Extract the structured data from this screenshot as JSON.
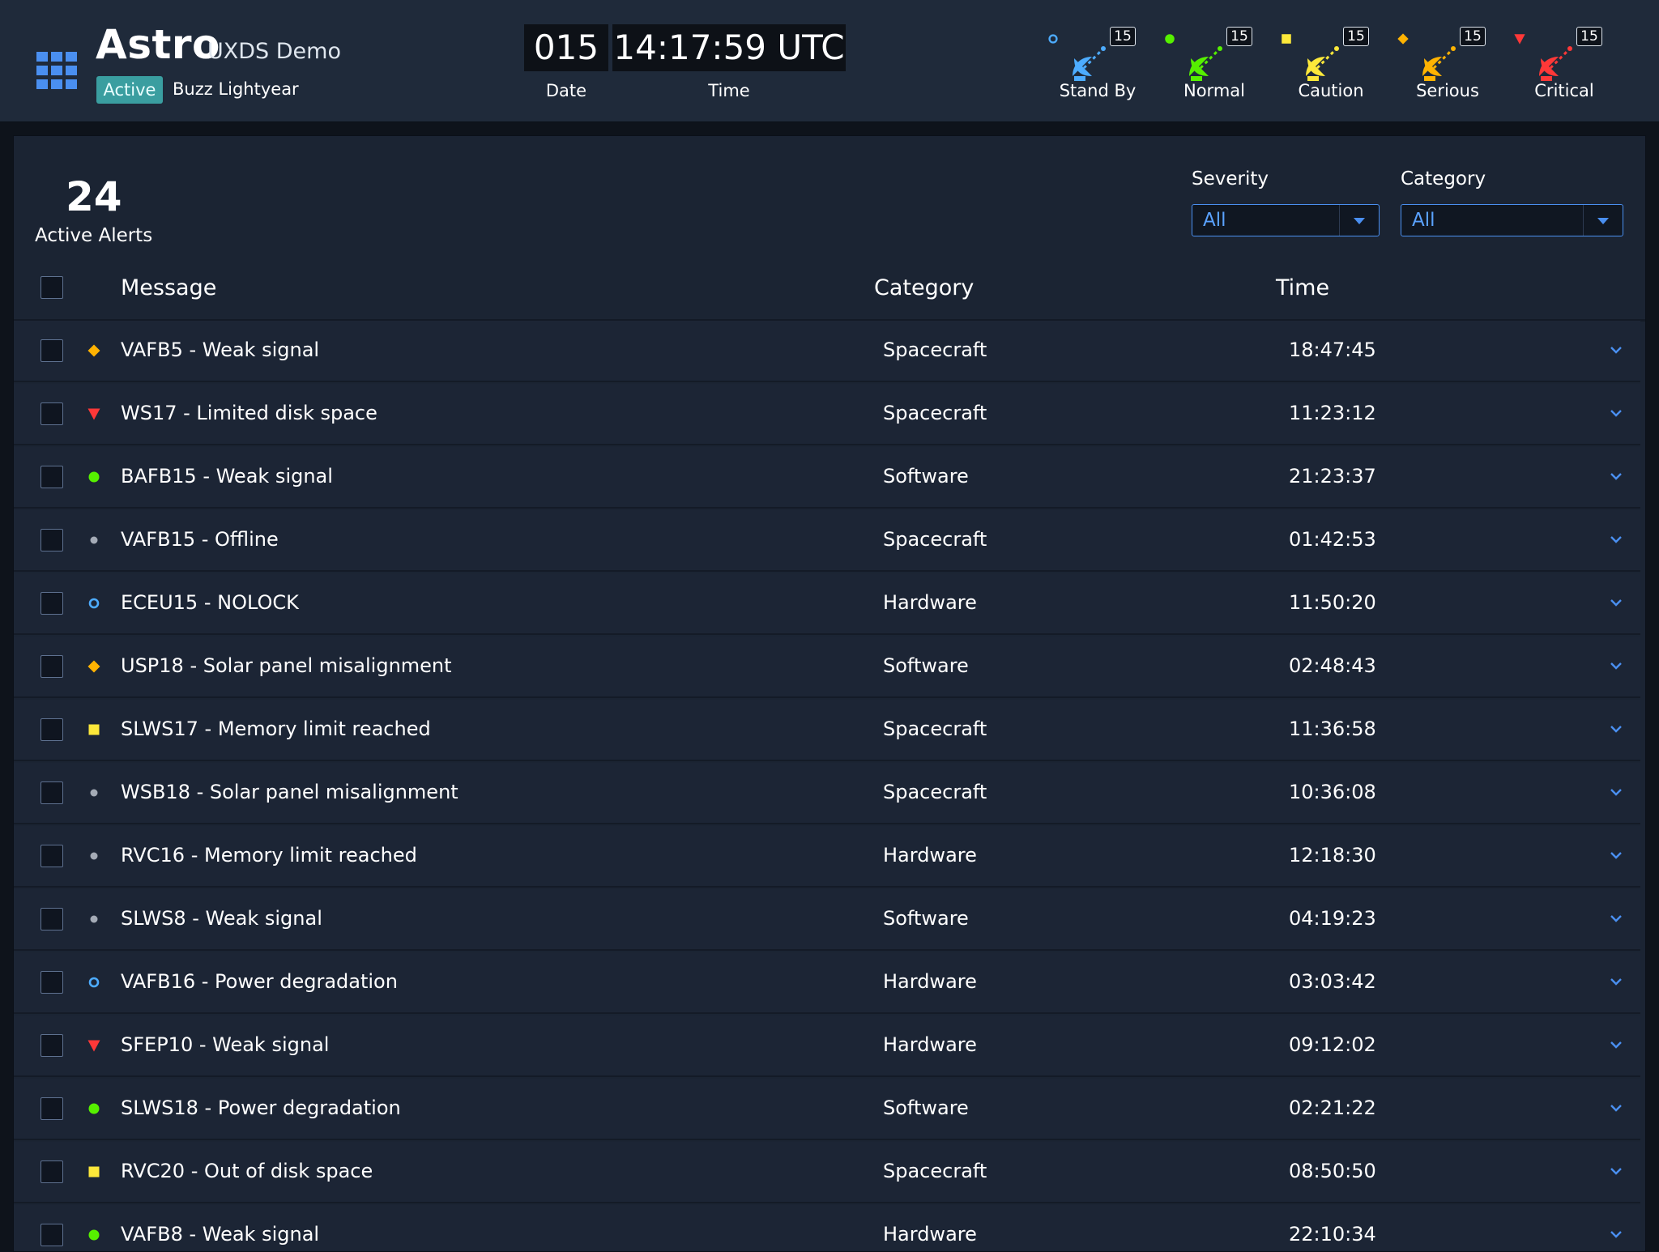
{
  "header": {
    "app_name": "Astro",
    "app_subtitle": "UXDS Demo",
    "state": "Active",
    "user": "Buzz Lightyear",
    "date_value": "015",
    "date_label": "Date",
    "time_value": "14:17:59 UTC",
    "time_label": "Time"
  },
  "monitoring": [
    {
      "label": "Stand By",
      "count": "15",
      "color": "#4dacff",
      "icon": "standby-icon"
    },
    {
      "label": "Normal",
      "count": "15",
      "color": "#56f000",
      "icon": "normal-icon"
    },
    {
      "label": "Caution",
      "count": "15",
      "color": "#fce83a",
      "icon": "caution-icon"
    },
    {
      "label": "Serious",
      "count": "15",
      "color": "#ffb302",
      "icon": "serious-icon"
    },
    {
      "label": "Critical",
      "count": "15",
      "color": "#ff3838",
      "icon": "critical-icon"
    }
  ],
  "alerts": {
    "count": "24",
    "count_label": "Active Alerts",
    "severity_label": "Severity",
    "severity_value": "All",
    "category_label": "Category",
    "category_value": "All",
    "columns": {
      "message": "Message",
      "category": "Category",
      "time": "Time"
    },
    "rows": [
      {
        "severity": "serious",
        "message": "VAFB5 - Weak signal",
        "category": "Spacecraft",
        "time": "18:47:45"
      },
      {
        "severity": "critical",
        "message": "WS17 - Limited disk space",
        "category": "Spacecraft",
        "time": "11:23:12"
      },
      {
        "severity": "normal",
        "message": "BAFB15 - Weak signal",
        "category": "Software",
        "time": "21:23:37"
      },
      {
        "severity": "off",
        "message": "VAFB15 - Offline",
        "category": "Spacecraft",
        "time": "01:42:53"
      },
      {
        "severity": "standby",
        "message": "ECEU15 - NOLOCK",
        "category": "Hardware",
        "time": "11:50:20"
      },
      {
        "severity": "serious",
        "message": "USP18 - Solar panel misalignment",
        "category": "Software",
        "time": "02:48:43"
      },
      {
        "severity": "caution",
        "message": "SLWS17 - Memory limit reached",
        "category": "Spacecraft",
        "time": "11:36:58"
      },
      {
        "severity": "off",
        "message": "WSB18 - Solar panel misalignment",
        "category": "Spacecraft",
        "time": "10:36:08"
      },
      {
        "severity": "off",
        "message": "RVC16 - Memory limit reached",
        "category": "Hardware",
        "time": "12:18:30"
      },
      {
        "severity": "off",
        "message": "SLWS8 - Weak signal",
        "category": "Software",
        "time": "04:19:23"
      },
      {
        "severity": "standby",
        "message": "VAFB16 - Power degradation",
        "category": "Hardware",
        "time": "03:03:42"
      },
      {
        "severity": "critical",
        "message": "SFEP10 - Weak signal",
        "category": "Hardware",
        "time": "09:12:02"
      },
      {
        "severity": "normal",
        "message": "SLWS18 - Power degradation",
        "category": "Software",
        "time": "02:21:22"
      },
      {
        "severity": "caution",
        "message": "RVC20 - Out of disk space",
        "category": "Spacecraft",
        "time": "08:50:50"
      },
      {
        "severity": "normal",
        "message": "VAFB8 - Weak signal",
        "category": "Hardware",
        "time": "22:10:34"
      }
    ]
  },
  "colors": {
    "standby": "#4dacff",
    "normal": "#56f000",
    "caution": "#fce83a",
    "serious": "#ffb302",
    "critical": "#ff3838",
    "off": "#a4abb6",
    "accent": "#4a8ff0"
  }
}
